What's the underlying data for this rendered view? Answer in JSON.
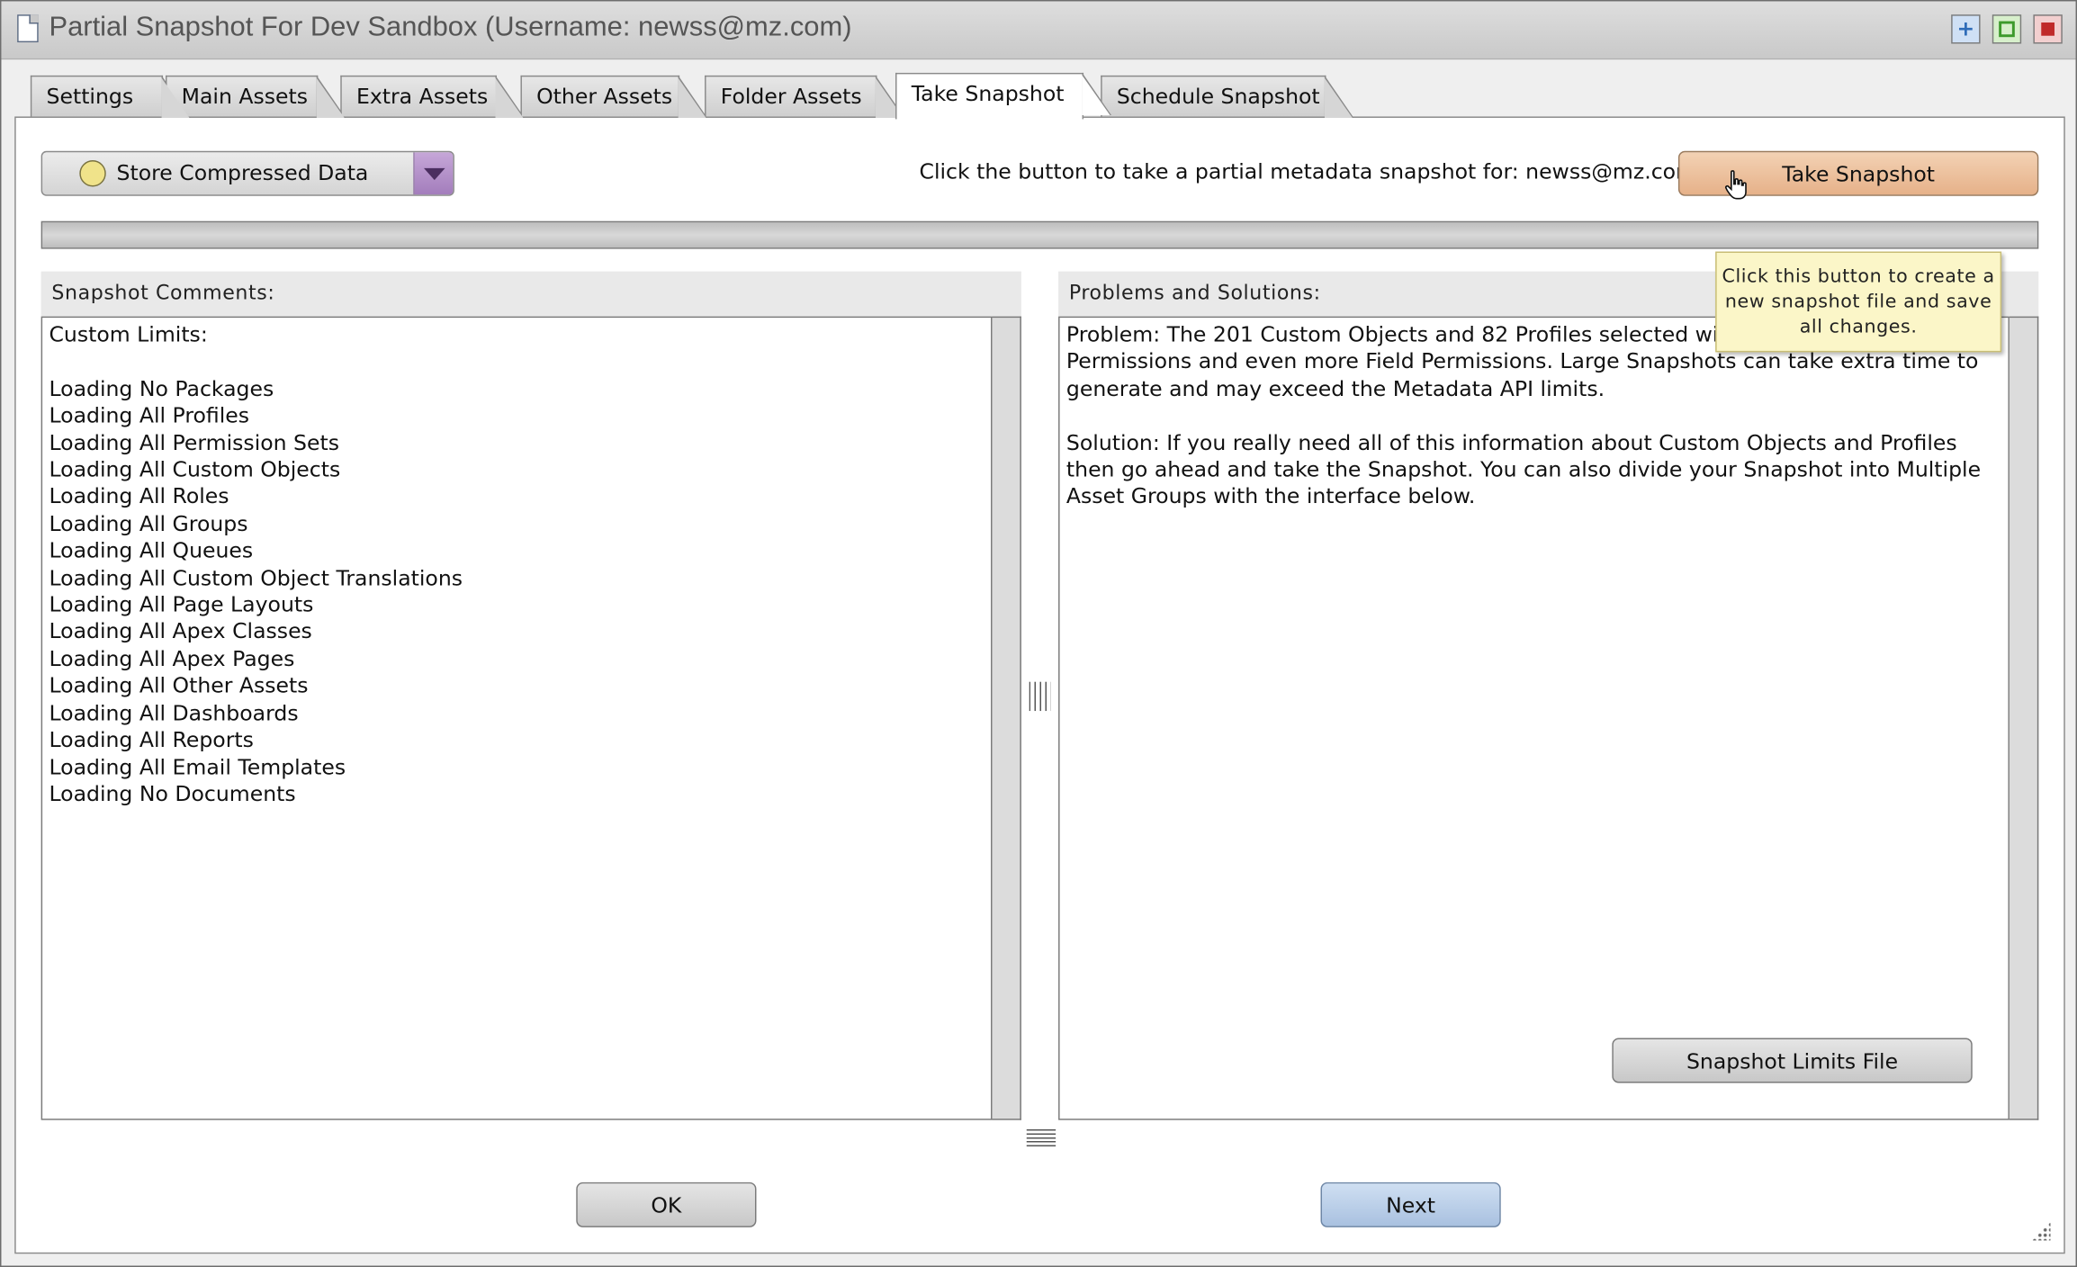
{
  "window": {
    "title": "Partial Snapshot For Dev Sandbox (Username: newss@mz.com)",
    "controls": [
      "maximize-icon",
      "restore-icon",
      "close-icon"
    ]
  },
  "tabs": [
    {
      "label": "Settings",
      "active": false
    },
    {
      "label": "Main Assets",
      "active": false
    },
    {
      "label": "Extra Assets",
      "active": false
    },
    {
      "label": "Other Assets",
      "active": false
    },
    {
      "label": "Folder Assets",
      "active": false
    },
    {
      "label": "Take Snapshot",
      "active": true
    },
    {
      "label": "Schedule Snapshot",
      "active": false
    }
  ],
  "storage_select": {
    "value": "Store Compressed Data",
    "status_color": "#f0e38a"
  },
  "snapshot_info": "Click the button to take a partial metadata snapshot for: newss@mz.com",
  "take_snapshot_button": "Take Snapshot",
  "tooltip": "Click this button to create a new snapshot file and save all changes.",
  "progress": 0,
  "comments": {
    "label": "Snapshot Comments:",
    "text": "Custom Limits:\n\nLoading No Packages\nLoading All Profiles\nLoading All Permission Sets\nLoading All Custom Objects\nLoading All Roles\nLoading All Groups\nLoading All Queues\nLoading All Custom Object Translations\nLoading All Page Layouts\nLoading All Apex Classes\nLoading All Apex Pages\nLoading All Other Assets\nLoading All Dashboards\nLoading All Reports\nLoading All Email Templates\nLoading No Documents"
  },
  "problems": {
    "label": "Problems and Solutions:",
    "problem": "Problem: The 201 Custom Objects and 82 Profiles selected will generate many Object Permissions and even more Field Permissions. Large Snapshots can take extra time to generate and may exceed the Metadata API limits.",
    "solution": "Solution: If you really need all of this information about Custom Objects and Profiles then go ahead and take the Snapshot. You can also divide your Snapshot into Multiple Asset Groups with the interface below."
  },
  "limits_button": "Snapshot Limits File",
  "footer": {
    "ok": "OK",
    "next": "Next"
  },
  "colors": {
    "take_snapshot": "#e6b189",
    "next": "#a9c1e0",
    "dropdown_arrow": "#a37dbc"
  }
}
